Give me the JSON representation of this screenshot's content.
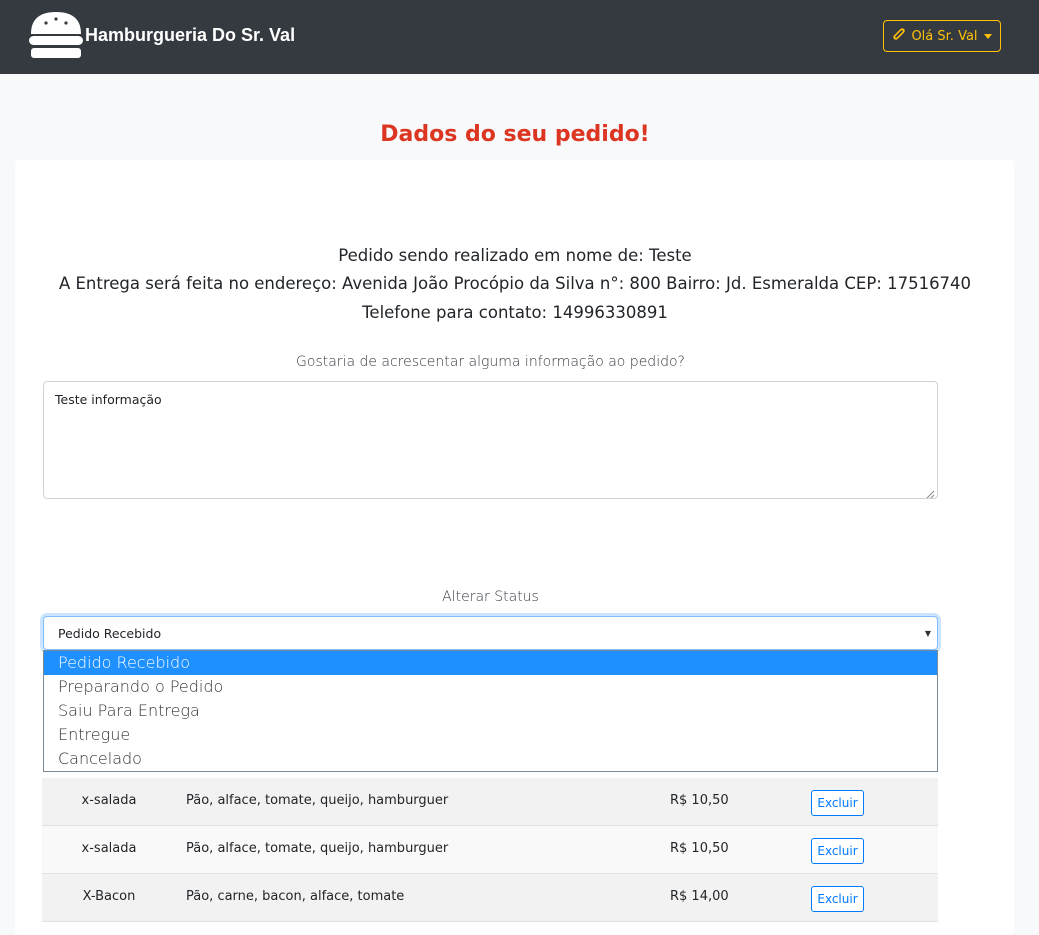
{
  "brand": {
    "name": "Hamburgueria Do Sr. Val",
    "logo_icon": "burger-icon"
  },
  "user_menu": {
    "label": "Olá Sr. Val",
    "icon": "hotdog-icon"
  },
  "colors": {
    "navbar": "#343a40",
    "accent": "#ffc107",
    "title": "#dc3522",
    "primary": "#007bff"
  },
  "page": {
    "title": "Dados do seu pedido!"
  },
  "order": {
    "name_line": "Pedido sendo realizado em nome de: Teste",
    "address_line": "A Entrega será feita no endereço: Avenida João Procópio da Silva n°: 800 Bairro: Jd. Esmeralda CEP: 17516740",
    "phone_line": "Telefone para contato: 14996330891"
  },
  "extra_info": {
    "label": "Gostaria de acrescentar alguma informação ao pedido?",
    "value": "Teste informação"
  },
  "status": {
    "label": "Alterar Status",
    "selected": "Pedido Recebido",
    "options": [
      "Pedido Recebido",
      "Preparando o Pedido",
      "Saiu Para Entrega",
      "Entregue",
      "Cancelado"
    ]
  },
  "items": [
    {
      "name": "x-salada",
      "description": "Pão, alface, tomate, queijo, hamburguer",
      "price": "R$ 10,50",
      "action": "Excluir"
    },
    {
      "name": "x-salada",
      "description": "Pão, alface, tomate, queijo, hamburguer",
      "price": "R$ 10,50",
      "action": "Excluir"
    },
    {
      "name": "X-Bacon",
      "description": "Pão, carne, bacon, alface, tomate",
      "price": "R$ 14,00",
      "action": "Excluir"
    }
  ]
}
